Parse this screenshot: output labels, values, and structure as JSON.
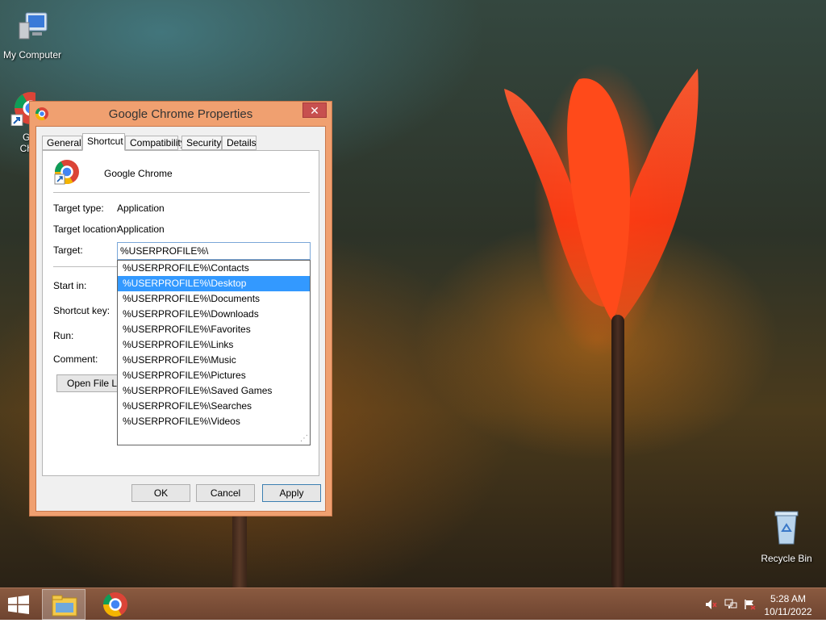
{
  "desktop": {
    "icons": [
      {
        "label": "My Computer"
      },
      {
        "label": "Go\nChr"
      },
      {
        "label": "Recycle Bin"
      }
    ]
  },
  "window": {
    "title": "Google Chrome Properties",
    "close_symbol": "✕",
    "tabs": [
      {
        "label": "General"
      },
      {
        "label": "Shortcut"
      },
      {
        "label": "Compatibility"
      },
      {
        "label": "Security"
      },
      {
        "label": "Details"
      }
    ],
    "app_name": "Google Chrome",
    "fields": {
      "target_type_label": "Target type:",
      "target_type_value": "Application",
      "target_location_label": "Target location:",
      "target_location_value": "Application",
      "target_label": "Target:",
      "target_value": "%USERPROFILE%\\",
      "start_in_label": "Start in:",
      "shortcut_key_label": "Shortcut key:",
      "run_label": "Run:",
      "comment_label": "Comment:"
    },
    "autocomplete": [
      "%USERPROFILE%\\Contacts",
      "%USERPROFILE%\\Desktop",
      "%USERPROFILE%\\Documents",
      "%USERPROFILE%\\Downloads",
      "%USERPROFILE%\\Favorites",
      "%USERPROFILE%\\Links",
      "%USERPROFILE%\\Music",
      "%USERPROFILE%\\Pictures",
      "%USERPROFILE%\\Saved Games",
      "%USERPROFILE%\\Searches",
      "%USERPROFILE%\\Videos"
    ],
    "autocomplete_selected": "%USERPROFILE%\\Desktop",
    "open_file_location_label": "Open File Lo",
    "buttons": {
      "ok": "OK",
      "cancel": "Cancel",
      "apply": "Apply"
    }
  },
  "taskbar": {
    "clock_time": "5:28 AM",
    "clock_date": "10/11/2022",
    "tray_icons": [
      "speaker-muted-icon",
      "network-icon",
      "action-center-flag-icon"
    ]
  },
  "colors": {
    "window_frame": "#f0a070",
    "selection": "#3399ff",
    "close_button": "#c7504f",
    "taskbar": "#7a4c36"
  }
}
